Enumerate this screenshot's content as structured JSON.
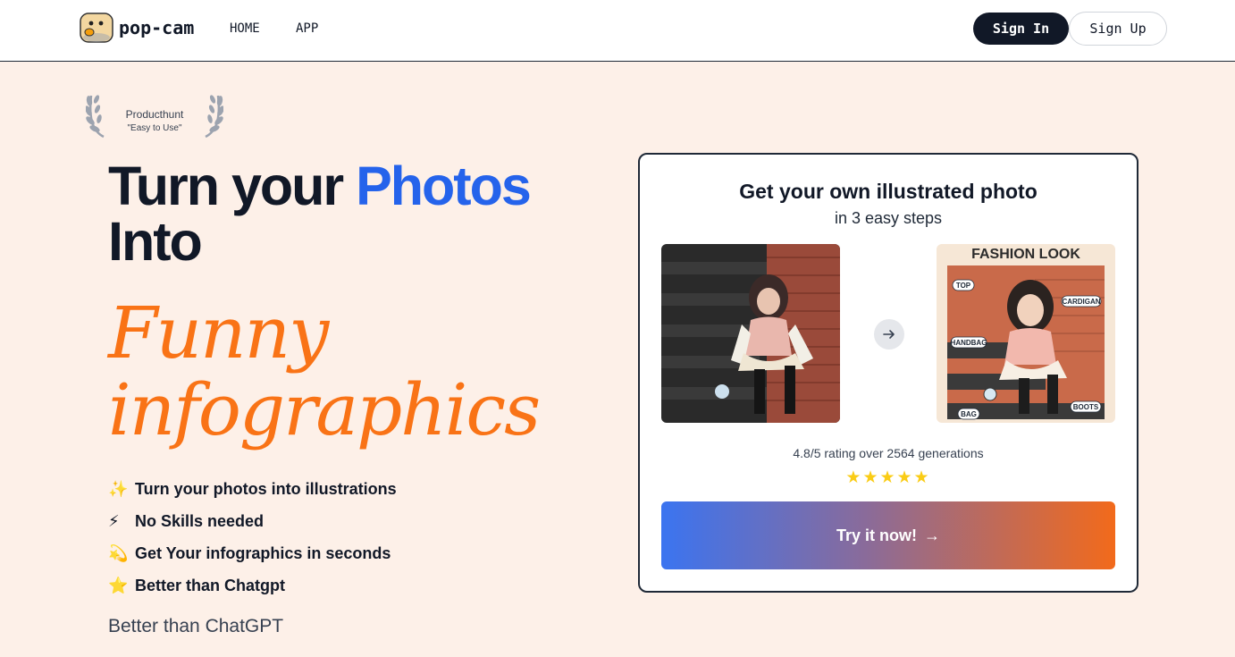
{
  "header": {
    "brand": "pop-cam",
    "nav": [
      {
        "label": "HOME"
      },
      {
        "label": "APP"
      }
    ],
    "sign_in": "Sign In",
    "sign_up": "Sign Up"
  },
  "award": {
    "title": "Producthunt",
    "subtitle": "\"Easy to Use\""
  },
  "hero": {
    "line1_prefix": "Turn your ",
    "line1_accent": "Photos",
    "line2": "Into",
    "script_line1": "Funny",
    "script_line2": "infographics",
    "features": [
      {
        "emoji": "✨",
        "text": "Turn your photos into illustrations"
      },
      {
        "emoji": "⚡",
        "text": "No Skills needed"
      },
      {
        "emoji": "💫",
        "text": "Get Your infographics in seconds"
      },
      {
        "emoji": "⭐",
        "text": "Better than Chatgpt"
      }
    ],
    "tagline": "Better than ChatGPT"
  },
  "card": {
    "title": "Get your own illustrated photo",
    "subtitle": "in 3 easy steps",
    "illustration": {
      "heading": "FASHION LOOK",
      "labels": [
        "TOP",
        "CARDIGAN",
        "HANDBAG",
        "BAG",
        "BOOTS"
      ]
    },
    "rating_text": "4.8/5 rating over 2564 generations",
    "stars": "★★★★★",
    "rating_value": 4.8,
    "cta_label": "Try it now!",
    "cta_arrow": "→"
  },
  "colors": {
    "background": "#fdf0e8",
    "accent_blue": "#2563eb",
    "accent_orange": "#f97316",
    "dark": "#111827"
  },
  "icons": [
    "pop-cam-logo-icon",
    "laurel-left-icon",
    "laurel-right-icon",
    "arrow-right-icon"
  ]
}
